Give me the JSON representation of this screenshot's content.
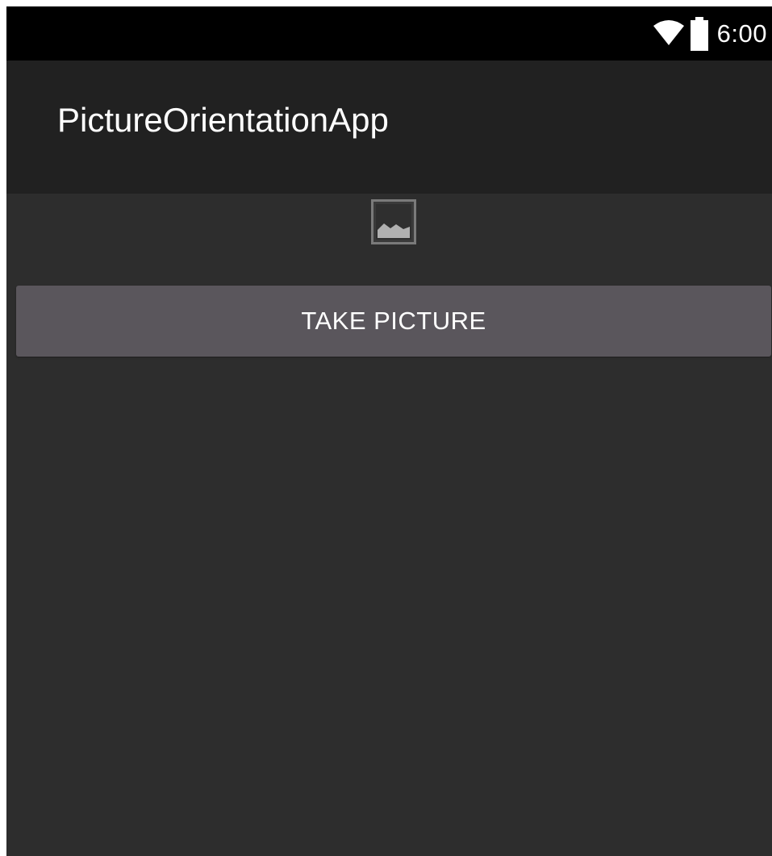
{
  "status_bar": {
    "time": "6:00",
    "icons": [
      "wifi-icon",
      "battery-icon"
    ]
  },
  "app_bar": {
    "title": "PictureOrientationApp"
  },
  "content": {
    "image_placeholder_icon": "image-icon",
    "take_picture_label": "TAKE PICTURE"
  },
  "colors": {
    "status_bar": "#000000",
    "app_bar": "#212121",
    "background": "#2d2d2d",
    "button": "#5a565c",
    "text": "#ffffff"
  }
}
